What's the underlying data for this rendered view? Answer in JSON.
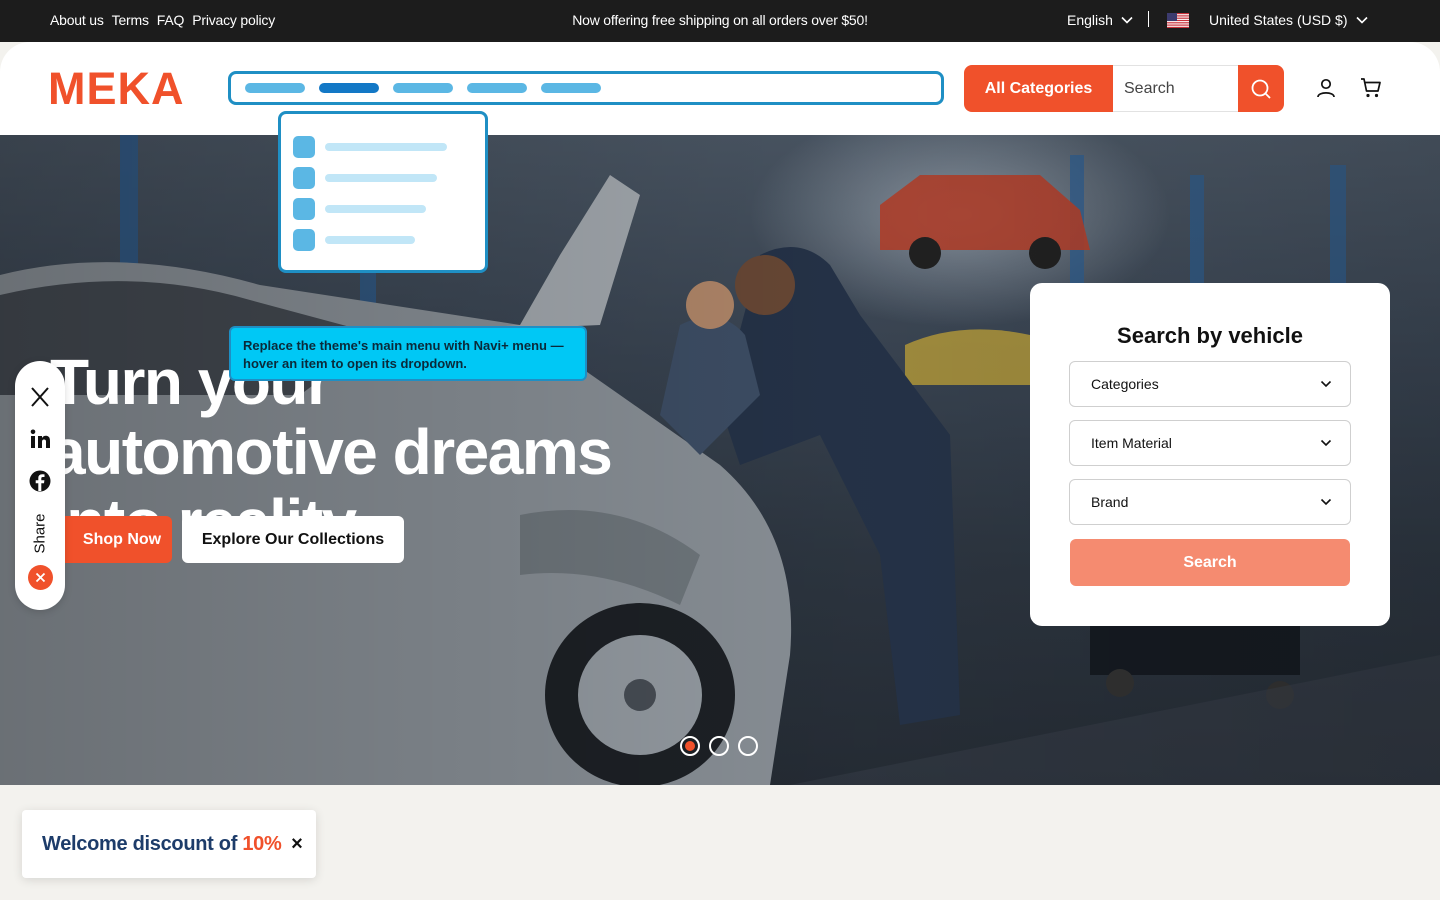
{
  "topbar": {
    "links": [
      "About us",
      "Terms",
      "FAQ",
      "Privacy policy"
    ],
    "announcement": "Now offering free shipping on all orders over $50!",
    "language": "English",
    "currency": "United States (USD $)"
  },
  "header": {
    "logo": "MEKA",
    "all_categories": "All Categories",
    "search_placeholder": "Search",
    "icons": [
      "search-icon",
      "user-icon",
      "cart-icon"
    ]
  },
  "navi_tooltip": "Replace the theme's main menu with Navi+ menu — hover an item to open its dropdown.",
  "hero": {
    "title": "Turn your automotive dreams into reality.",
    "shop_button": "Shop Now",
    "explore_button": "Explore Our Collections",
    "slides": 3,
    "active_slide": 1
  },
  "vehicle_search": {
    "title": "Search by vehicle",
    "selects": [
      "Categories",
      "Item Material",
      "Brand"
    ],
    "button": "Search"
  },
  "share": {
    "label": "Share",
    "icons": [
      "x-icon",
      "linkedin-icon",
      "facebook-icon",
      "close-icon"
    ]
  },
  "welcome": {
    "text": "Welcome discount of ",
    "percent": "10%",
    "close": "×"
  },
  "colors": {
    "brand": "#f0512b",
    "navi_blue": "#1f8fc4",
    "tooltip": "#00c8f5",
    "dark": "#1c1c1c"
  }
}
